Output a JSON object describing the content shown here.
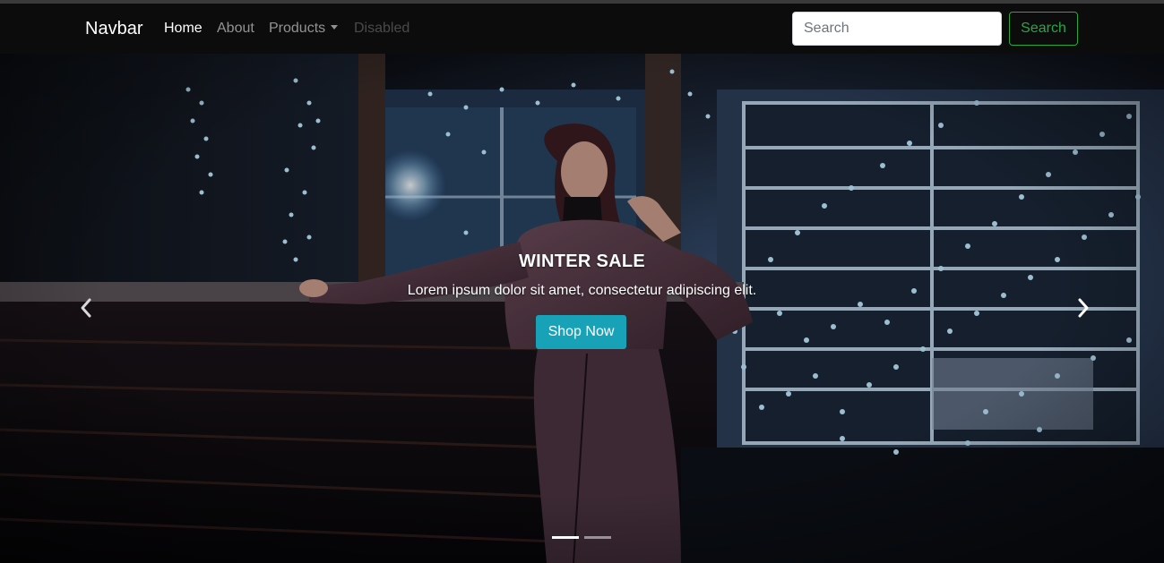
{
  "navbar": {
    "brand": "Navbar",
    "links": [
      {
        "label": "Home",
        "state": "active"
      },
      {
        "label": "About",
        "state": "normal"
      },
      {
        "label": "Products",
        "state": "dropdown"
      },
      {
        "label": "Disabled",
        "state": "disabled"
      }
    ],
    "search": {
      "placeholder": "Search",
      "button_label": "Search"
    }
  },
  "carousel": {
    "slide": {
      "title": "WINTER SALE",
      "text": "Lorem ipsum dolor sit amet, consectetur adipiscing elit.",
      "button_label": "Shop Now"
    },
    "indicators_count": 2,
    "active_indicator": 0,
    "prev_icon": "chevron-left-icon",
    "next_icon": "chevron-right-icon"
  },
  "colors": {
    "navbar_bg": "#0c0c0c",
    "search_button": "#28a745",
    "shop_button": "#17a2b8"
  }
}
